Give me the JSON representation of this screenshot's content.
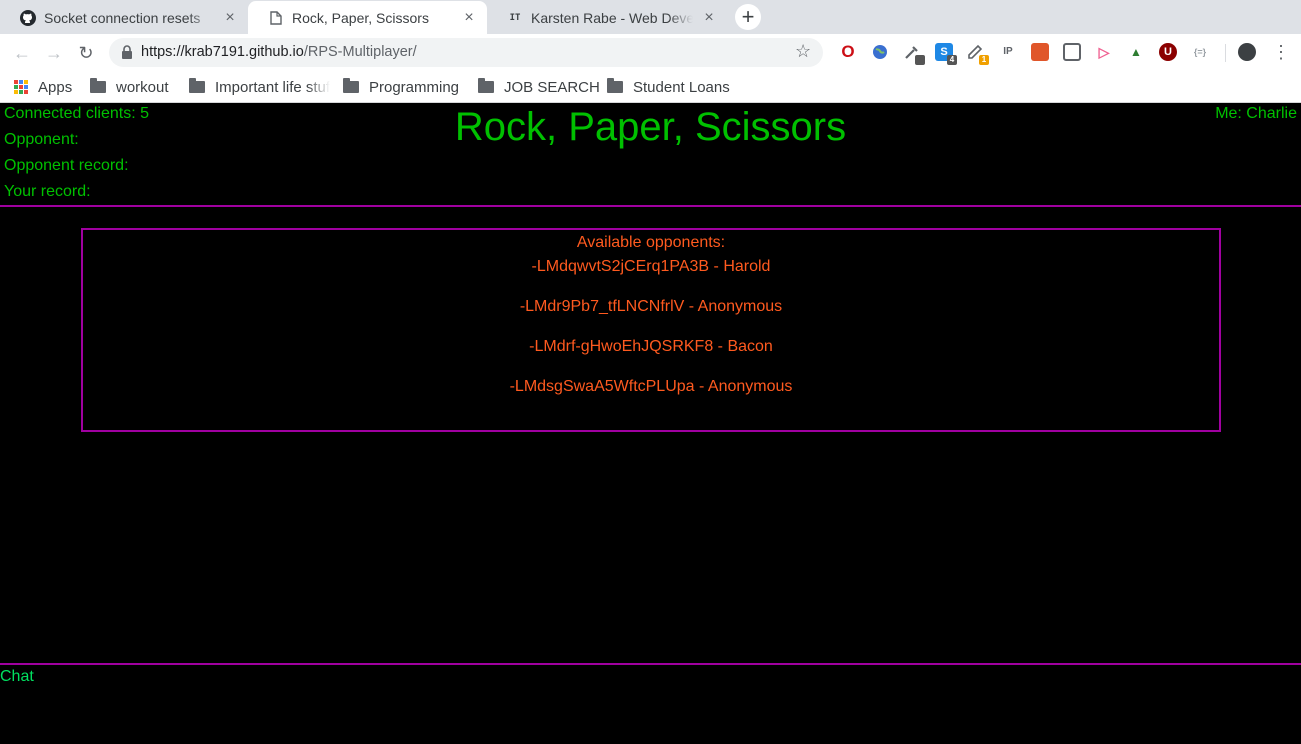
{
  "browser": {
    "tabs": [
      {
        "title": "Socket connection resets",
        "icon": "github-icon",
        "active": false
      },
      {
        "title": "Rock, Paper, Scissors",
        "icon": "page-icon",
        "active": true
      },
      {
        "title": "Karsten Rabe - Web Developer",
        "icon": "it-icon",
        "active": false
      }
    ],
    "tab_icon_text": "IT",
    "url_host": "https://krab7191.github.io",
    "url_path": "/RPS-Multiplayer/",
    "extension_badges": [
      "",
      "4",
      "1"
    ],
    "bookmarks": [
      {
        "label": "Apps",
        "icon": "apps-grid-icon"
      },
      {
        "label": "workout",
        "icon": "folder-icon"
      },
      {
        "label": "Important life stuff",
        "icon": "folder-icon"
      },
      {
        "label": "Programming",
        "icon": "folder-icon"
      },
      {
        "label": "JOB SEARCH",
        "icon": "folder-icon"
      },
      {
        "label": "Student Loans",
        "icon": "folder-icon"
      }
    ]
  },
  "game": {
    "title": "Rock, Paper, Scissors",
    "connected_clients": "Connected clients: 5",
    "opponent": "Opponent:",
    "opponent_record": "Opponent record:",
    "your_record": "Your record:",
    "me": "Me: Charlie",
    "available_header": "Available opponents:",
    "opponents": [
      "-LMdqwvtS2jCErq1PA3B - Harold",
      "-LMdr9Pb7_tfLNCNfrlV - Anonymous",
      "-LMdrf-gHwoEhJQSRKF8 - Bacon",
      "-LMdsgSwaA5WftcPLUpa - Anonymous"
    ],
    "chat_label": "Chat"
  },
  "colors": {
    "page_background": "#000000",
    "green_text": "#00c000",
    "orange_text": "#ff5a1f",
    "purple_divider": "#a000a0",
    "chat_green": "#00e060"
  }
}
